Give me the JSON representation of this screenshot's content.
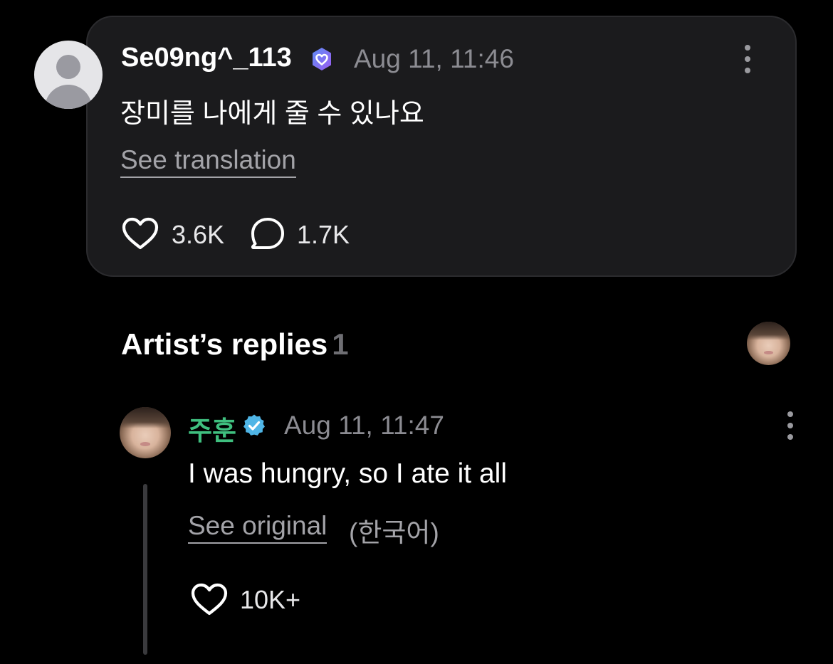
{
  "comment": {
    "username": "Se09ng^_113",
    "badge_icon": "fan-heart-badge-icon",
    "timestamp": "Aug 11, 11:46",
    "text": "장미를 나에게 줄 수 있나요",
    "translate_link": "See translation",
    "likes": "3.6K",
    "replies": "1.7K",
    "menu_icon": "more-vertical-icon"
  },
  "artist_replies": {
    "title": "Artist’s replies",
    "count": "1"
  },
  "reply": {
    "username": "주훈",
    "badge_icon": "verified-badge-icon",
    "timestamp": "Aug 11, 11:47",
    "text": "I was hungry, so I ate it all",
    "original_link": "See original",
    "original_language": "(한국어)",
    "likes": "10K+",
    "menu_icon": "more-vertical-icon"
  },
  "colors": {
    "background": "#000000",
    "card": "#1b1b1d",
    "artist_name": "#3fbf7f",
    "verified_badge": "#4fb5e6",
    "fan_badge": "#7a6df0",
    "muted_text": "#8c8c92"
  }
}
